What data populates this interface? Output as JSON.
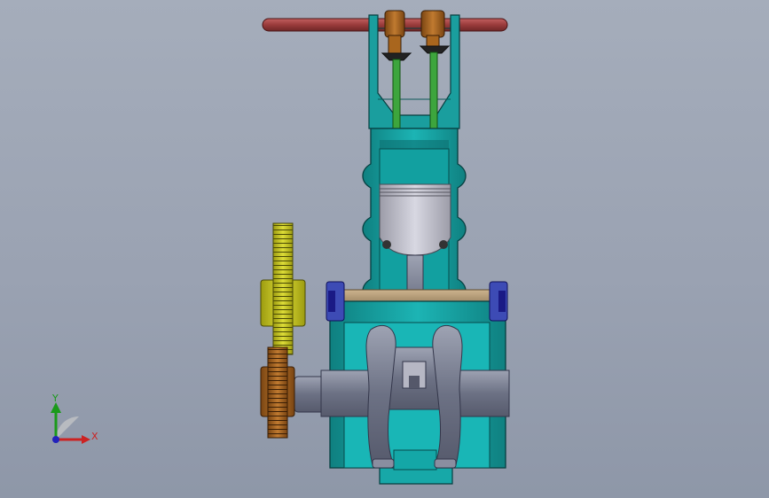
{
  "viewport": {
    "background_top": "#a5adbb",
    "background_bottom": "#8e97a8"
  },
  "model": {
    "parts": [
      "camshaft",
      "cam-lobe-left",
      "cam-lobe-right",
      "valve-intake",
      "valve-exhaust",
      "cylinder-block",
      "piston",
      "connecting-rod",
      "crankshaft",
      "crank-web-left",
      "crank-web-right",
      "crankcase",
      "main-bearing-left",
      "main-bearing-right",
      "timing-gear-large",
      "timing-gear-small"
    ],
    "colors": {
      "block": "#17a3a3",
      "block_dark": "#0d6f72",
      "camshaft": "#9a3b3b",
      "cam_follower": "#b8661e",
      "valve": "#3da53d",
      "piston": "#bfbfcb",
      "steel": "#7a7f92",
      "gear_large": "#c3c21a",
      "gear_small": "#a9661e",
      "bearing_cap": "#2222aa",
      "shaft_tan": "#b39a74"
    }
  },
  "triad": {
    "x_label": "X",
    "y_label": "Y",
    "x_color": "#cc2222",
    "y_color": "#1a9a1a",
    "z_color": "#2222bb"
  }
}
